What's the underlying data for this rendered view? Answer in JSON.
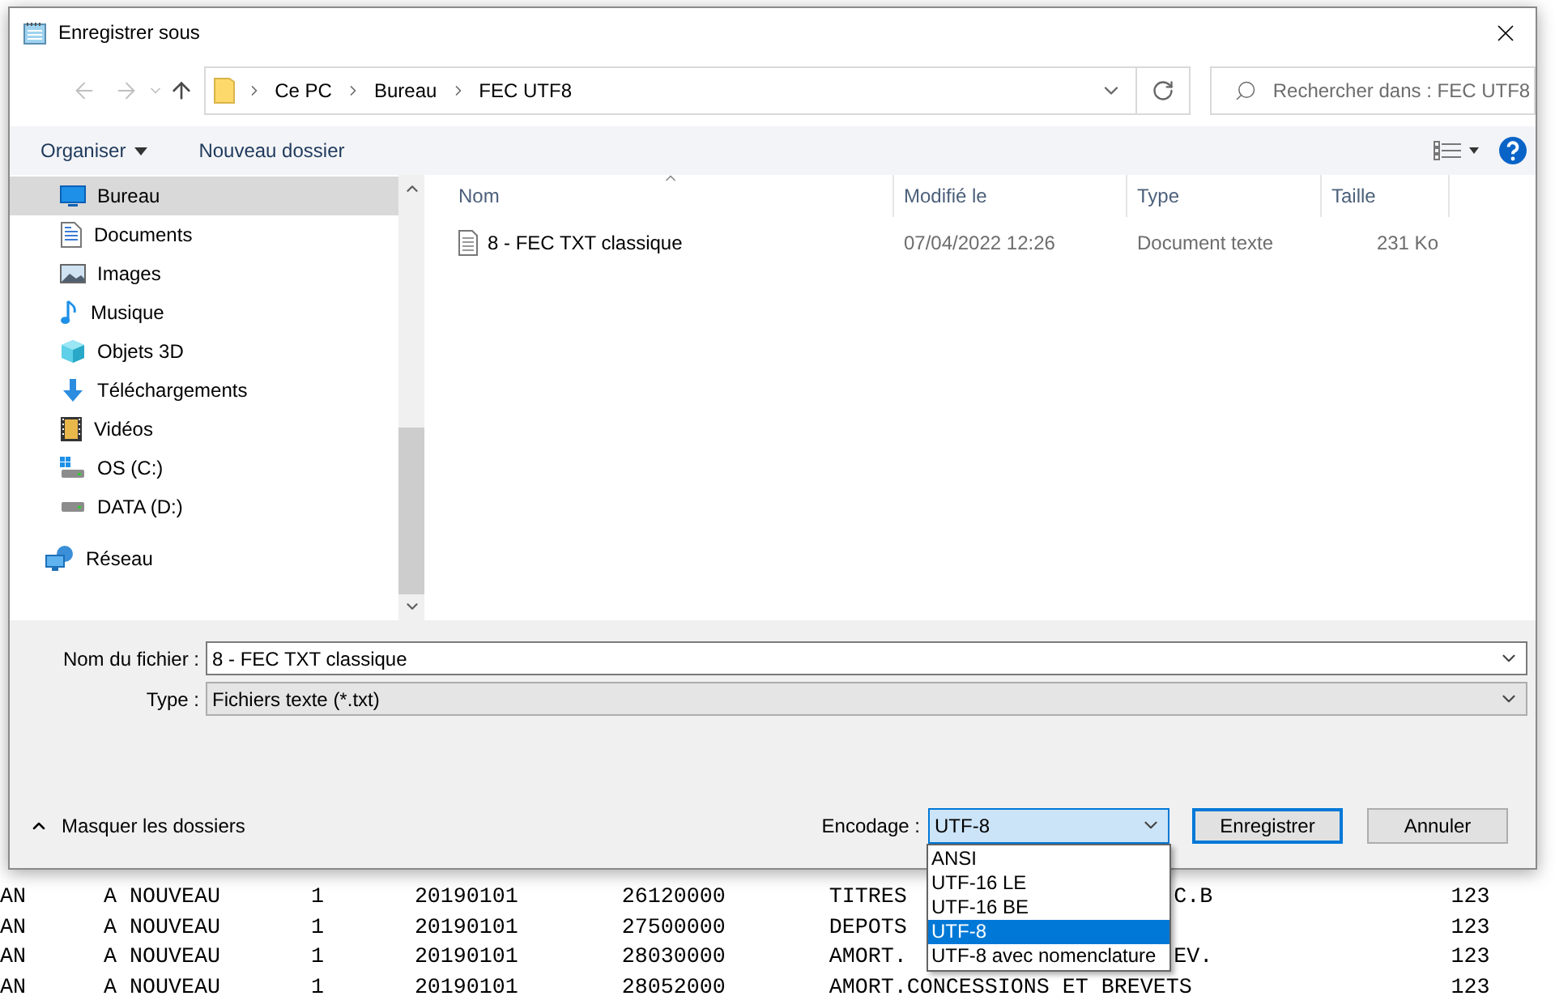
{
  "window": {
    "title": "Enregistrer sous"
  },
  "address_bar": {
    "path": [
      "Ce PC",
      "Bureau",
      "FEC UTF8"
    ]
  },
  "search": {
    "placeholder": "Rechercher dans : FEC UTF8"
  },
  "toolbar": {
    "organize": "Organiser",
    "new_folder": "Nouveau dossier"
  },
  "sidebar": {
    "items": [
      {
        "label": "Bureau",
        "kind": "child",
        "selected": true
      },
      {
        "label": "Documents",
        "kind": "child",
        "selected": false
      },
      {
        "label": "Images",
        "kind": "child",
        "selected": false
      },
      {
        "label": "Musique",
        "kind": "child",
        "selected": false
      },
      {
        "label": "Objets 3D",
        "kind": "child",
        "selected": false
      },
      {
        "label": "Téléchargements",
        "kind": "child",
        "selected": false
      },
      {
        "label": "Vidéos",
        "kind": "child",
        "selected": false
      },
      {
        "label": "OS (C:)",
        "kind": "child",
        "selected": false
      },
      {
        "label": "DATA (D:)",
        "kind": "child",
        "selected": false
      },
      {
        "label": "Réseau",
        "kind": "root",
        "selected": false
      }
    ]
  },
  "file_list": {
    "columns": [
      {
        "label": "Nom",
        "sorted": true
      },
      {
        "label": "Modifié le",
        "sorted": false
      },
      {
        "label": "Type",
        "sorted": false
      },
      {
        "label": "Taille",
        "sorted": false
      }
    ],
    "rows": [
      {
        "name": "8 - FEC TXT classique",
        "modified": "07/04/2022 12:26",
        "type": "Document texte",
        "size": "231 Ko"
      }
    ]
  },
  "form": {
    "filename": {
      "label": "Nom du fichier :",
      "value": "8 - FEC TXT classique"
    },
    "type": {
      "label": "Type :",
      "value": "Fichiers texte (*.txt)"
    }
  },
  "footer": {
    "hide_folders": "Masquer les dossiers",
    "encoding": {
      "label": "Encodage :",
      "value": "UTF-8",
      "expanded": true,
      "options": [
        {
          "label": "ANSI",
          "selected": false
        },
        {
          "label": "UTF-16 LE",
          "selected": false
        },
        {
          "label": "UTF-16 BE",
          "selected": false
        },
        {
          "label": "UTF-8",
          "selected": true
        },
        {
          "label": "UTF-8 avec nomenclature",
          "selected": false
        }
      ]
    },
    "buttons": [
      {
        "label": "Enregistrer",
        "default": true
      },
      {
        "label": "Annuler",
        "default": false
      }
    ]
  },
  "background_editor": {
    "rows": [
      {
        "journal": "AN",
        "journal_label": "A NOUVEAU",
        "number": "1",
        "date": "20190101",
        "account": "26120000",
        "label": "TITRES",
        "label_end": "C.B",
        "amount": "123"
      },
      {
        "journal": "AN",
        "journal_label": "A NOUVEAU",
        "number": "1",
        "date": "20190101",
        "account": "27500000",
        "label": "DEPOTS",
        "label_end": "",
        "amount": "123"
      },
      {
        "journal": "AN",
        "journal_label": "A NOUVEAU",
        "number": "1",
        "date": "20190101",
        "account": "28030000",
        "label": "AMORT.",
        "label_end": "EV.",
        "amount": "123"
      },
      {
        "journal": "AN",
        "journal_label": "A NOUVEAU",
        "number": "1",
        "date": "20190101",
        "account": "28052000",
        "label": "AMORT.CONCESSIONS ET BREVETS",
        "label_end": "",
        "amount": "123"
      }
    ]
  }
}
